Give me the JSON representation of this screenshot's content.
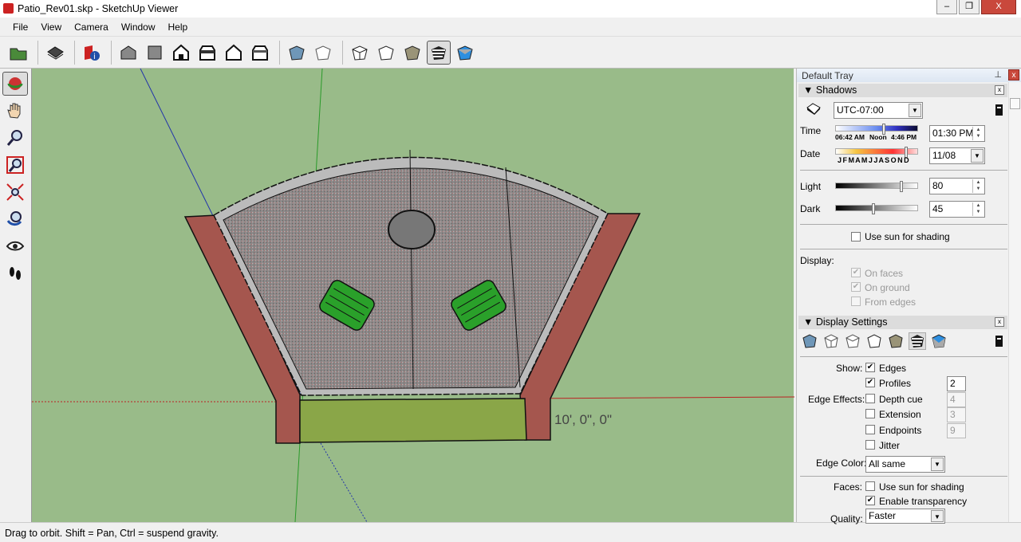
{
  "window": {
    "title": "Patio_Rev01.skp - SketchUp Viewer",
    "min": "0",
    "max": "❐",
    "close": "X"
  },
  "menu": [
    "File",
    "View",
    "Camera",
    "Window",
    "Help"
  ],
  "toolbar": {
    "icons": [
      "open-icon",
      "print-icon",
      "model-info-icon",
      "iso-view-icon",
      "top-view-icon",
      "front-view-icon",
      "right-view-icon",
      "back-view-icon",
      "left-view-icon",
      "xray-icon",
      "wireframe-icon",
      "hidden-line-icon",
      "shaded-icon",
      "shaded-textures-icon",
      "monochrome-icon"
    ],
    "active": "shaded-textures-icon"
  },
  "left_tools": [
    "orbit-icon",
    "pan-icon",
    "zoom-icon",
    "zoom-window-icon",
    "zoom-extents-icon",
    "previous-view-icon",
    "look-around-icon",
    "walk-icon"
  ],
  "viewport": {
    "dimension": "10', 0\", 0\"",
    "colors": {
      "ground": "#99bb89",
      "gravel": "#8e8a8a",
      "brick": "#a5564e",
      "grass": "#8aa648",
      "chairs": "#2aa02a"
    }
  },
  "status": "Drag to orbit. Shift = Pan, Ctrl = suspend gravity.",
  "tray": {
    "title": "Default Tray",
    "pin": "ᵖ",
    "close": "x",
    "shadows": {
      "title": "Shadows",
      "timezone": "UTC-07:00",
      "time_label": "Time",
      "time_ticks": [
        "06:42 AM",
        "Noon",
        "4:46 PM"
      ],
      "time_value": "01:30 PM",
      "date_label": "Date",
      "months": "J F M A M J J A S O N D",
      "date_value": "11/08",
      "light_label": "Light",
      "light": 80,
      "dark_label": "Dark",
      "dark": 45,
      "use_sun": "Use sun for shading",
      "display_label": "Display:",
      "on_faces": "On faces",
      "on_ground": "On ground",
      "from_edges": "From edges"
    },
    "display": {
      "title": "Display Settings",
      "show_label": "Show:",
      "edges": "Edges",
      "profiles": "Profiles",
      "profiles_val": "2",
      "effects_label": "Edge Effects:",
      "depth_cue": "Depth cue",
      "depth_val": "4",
      "extension": "Extension",
      "extension_val": "3",
      "endpoints": "Endpoints",
      "endpoints_val": "9",
      "jitter": "Jitter",
      "edge_color_label": "Edge Color:",
      "edge_color": "All same",
      "faces_label": "Faces:",
      "faces_sun": "Use sun for shading",
      "transparency": "Enable transparency",
      "quality_label": "Quality:",
      "quality": "Faster"
    }
  }
}
